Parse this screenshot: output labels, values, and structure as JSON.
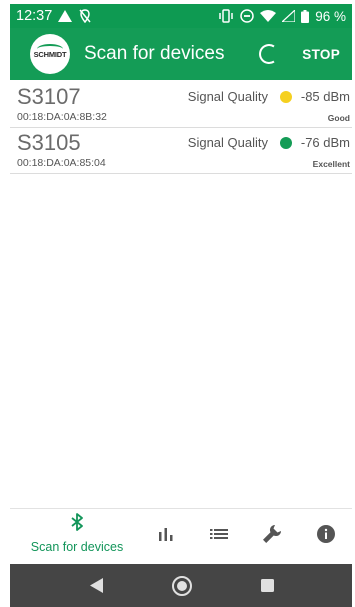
{
  "status_bar": {
    "time": "12:37",
    "battery": "96 %"
  },
  "app_bar": {
    "logo_text": "SCHMIDT",
    "title": "Scan for devices",
    "stop_label": "STOP"
  },
  "devices": [
    {
      "name": "S3107",
      "mac": "00:18:DA:0A:8B:32",
      "signal_label": "Signal Quality",
      "dbm": "-85 dBm",
      "quality": "Good",
      "dot_color": "#f5d020"
    },
    {
      "name": "S3105",
      "mac": "00:18:DA:0A:85:04",
      "signal_label": "Signal Quality",
      "dbm": "-76 dBm",
      "quality": "Excellent",
      "dot_color": "#149c56"
    }
  ],
  "bottom_nav": {
    "scan_label": "Scan for devices"
  },
  "colors": {
    "primary": "#149c56",
    "status_bar": "#0e9a52",
    "system_nav": "#454545"
  }
}
